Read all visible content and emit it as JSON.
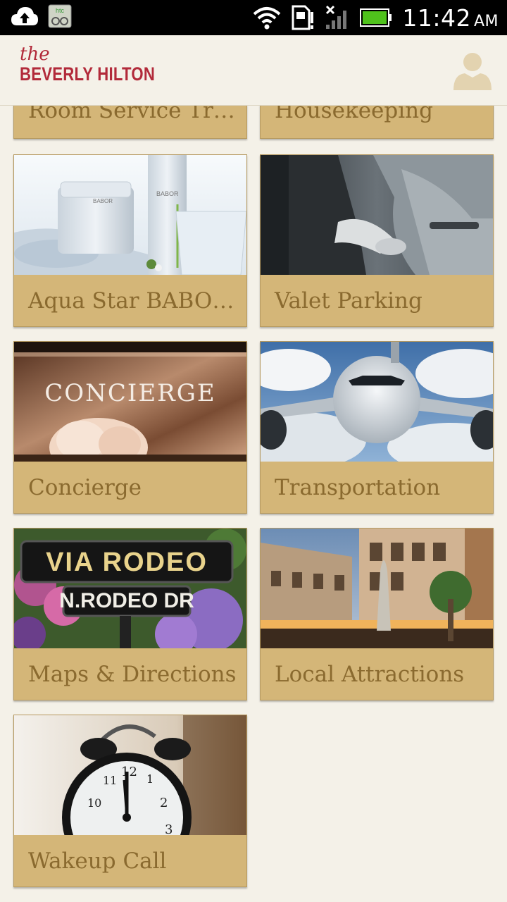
{
  "status_bar": {
    "time": "11:42",
    "ampm": "AM",
    "icons": [
      "cloud-upload-icon",
      "htc-sense-icon",
      "wifi-icon",
      "sim-alert-icon",
      "signal-none-icon",
      "battery-full-icon"
    ]
  },
  "header": {
    "logo_the": "the",
    "logo_name": "BEVERLY HILTON",
    "brand_color": "#b22a3a"
  },
  "tiles": [
    {
      "label": "Room Service Tr…"
    },
    {
      "label": "Housekeeping"
    },
    {
      "label": "Aqua Star BABO…"
    },
    {
      "label": "Valet Parking"
    },
    {
      "label": "Concierge",
      "image_text": "CONCIERGE"
    },
    {
      "label": "Transportation"
    },
    {
      "label": "Maps & Directions",
      "sign_top": "VIA RODEO",
      "sign_bottom": "N.RODEO DR"
    },
    {
      "label": "Local Attractions"
    },
    {
      "label": "Wakeup Call"
    }
  ],
  "colors": {
    "tile_bg": "#d4b678",
    "tile_text": "#8a6a2f",
    "page_bg": "#f4f1e8"
  }
}
